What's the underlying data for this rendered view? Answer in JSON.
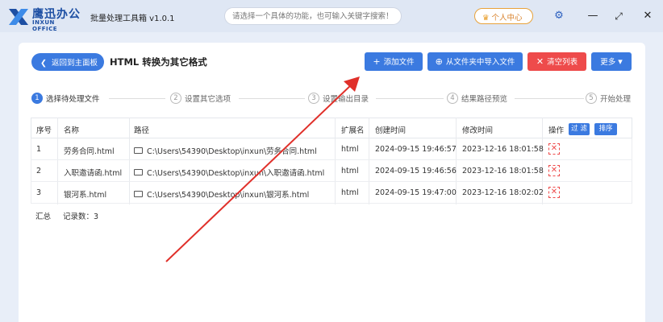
{
  "titlebar": {
    "logo_cn": "鹰迅办公",
    "logo_en": "INXUN OFFICE",
    "app_title": "批量处理工具箱 v1.0.1",
    "search_placeholder": "请选择一个具体的功能，也可输入关键字搜索！",
    "vip_label": "个人中心",
    "settings_icon": "gear-icon",
    "minimize_icon": "minimize-icon",
    "maximize_icon": "maximize-icon",
    "close_icon": "close-icon"
  },
  "header": {
    "back_label": "返回到主面板",
    "page_title": "HTML 转换为其它格式",
    "actions": [
      {
        "label": "添加文件",
        "icon": "+"
      },
      {
        "label": "从文件夹中导入文件",
        "icon": "⊕"
      },
      {
        "label": "清空列表",
        "icon": "✕"
      },
      {
        "label": "更多",
        "icon": "▾"
      }
    ]
  },
  "steps": [
    {
      "num": "1",
      "label": "选择待处理文件"
    },
    {
      "num": "2",
      "label": "设置其它选项"
    },
    {
      "num": "3",
      "label": "设置输出目录"
    },
    {
      "num": "4",
      "label": "结果路径预览"
    },
    {
      "num": "5",
      "label": "开始处理"
    }
  ],
  "table": {
    "headers": {
      "index": "序号",
      "name": "名称",
      "path": "路径",
      "ext": "扩展名",
      "created": "创建时间",
      "modified": "修改时间",
      "ops": "操作",
      "filter_btn": "过 滤",
      "sort_btn": "排序"
    },
    "rows": [
      {
        "index": "1",
        "name": "劳务合同.html",
        "path": "C:\\Users\\54390\\Desktop\\inxun\\劳务合同.html",
        "ext": "html",
        "created": "2024-09-15 19:46:57",
        "modified": "2023-12-16 18:01:58"
      },
      {
        "index": "2",
        "name": "入职邀请函.html",
        "path": "C:\\Users\\54390\\Desktop\\inxun\\入职邀请函.html",
        "ext": "html",
        "created": "2024-09-15 19:46:56",
        "modified": "2023-12-16 18:01:58"
      },
      {
        "index": "3",
        "name": "银河系.html",
        "path": "C:\\Users\\54390\\Desktop\\inxun\\银河系.html",
        "ext": "html",
        "created": "2024-09-15 19:47:00",
        "modified": "2023-12-16 18:02:02"
      }
    ],
    "summary_label": "汇总",
    "summary_count": "记录数：3"
  },
  "colors": {
    "accent": "#3b7ae0",
    "danger": "#ee4b4b",
    "annotation_arrow": "#e0302a"
  }
}
